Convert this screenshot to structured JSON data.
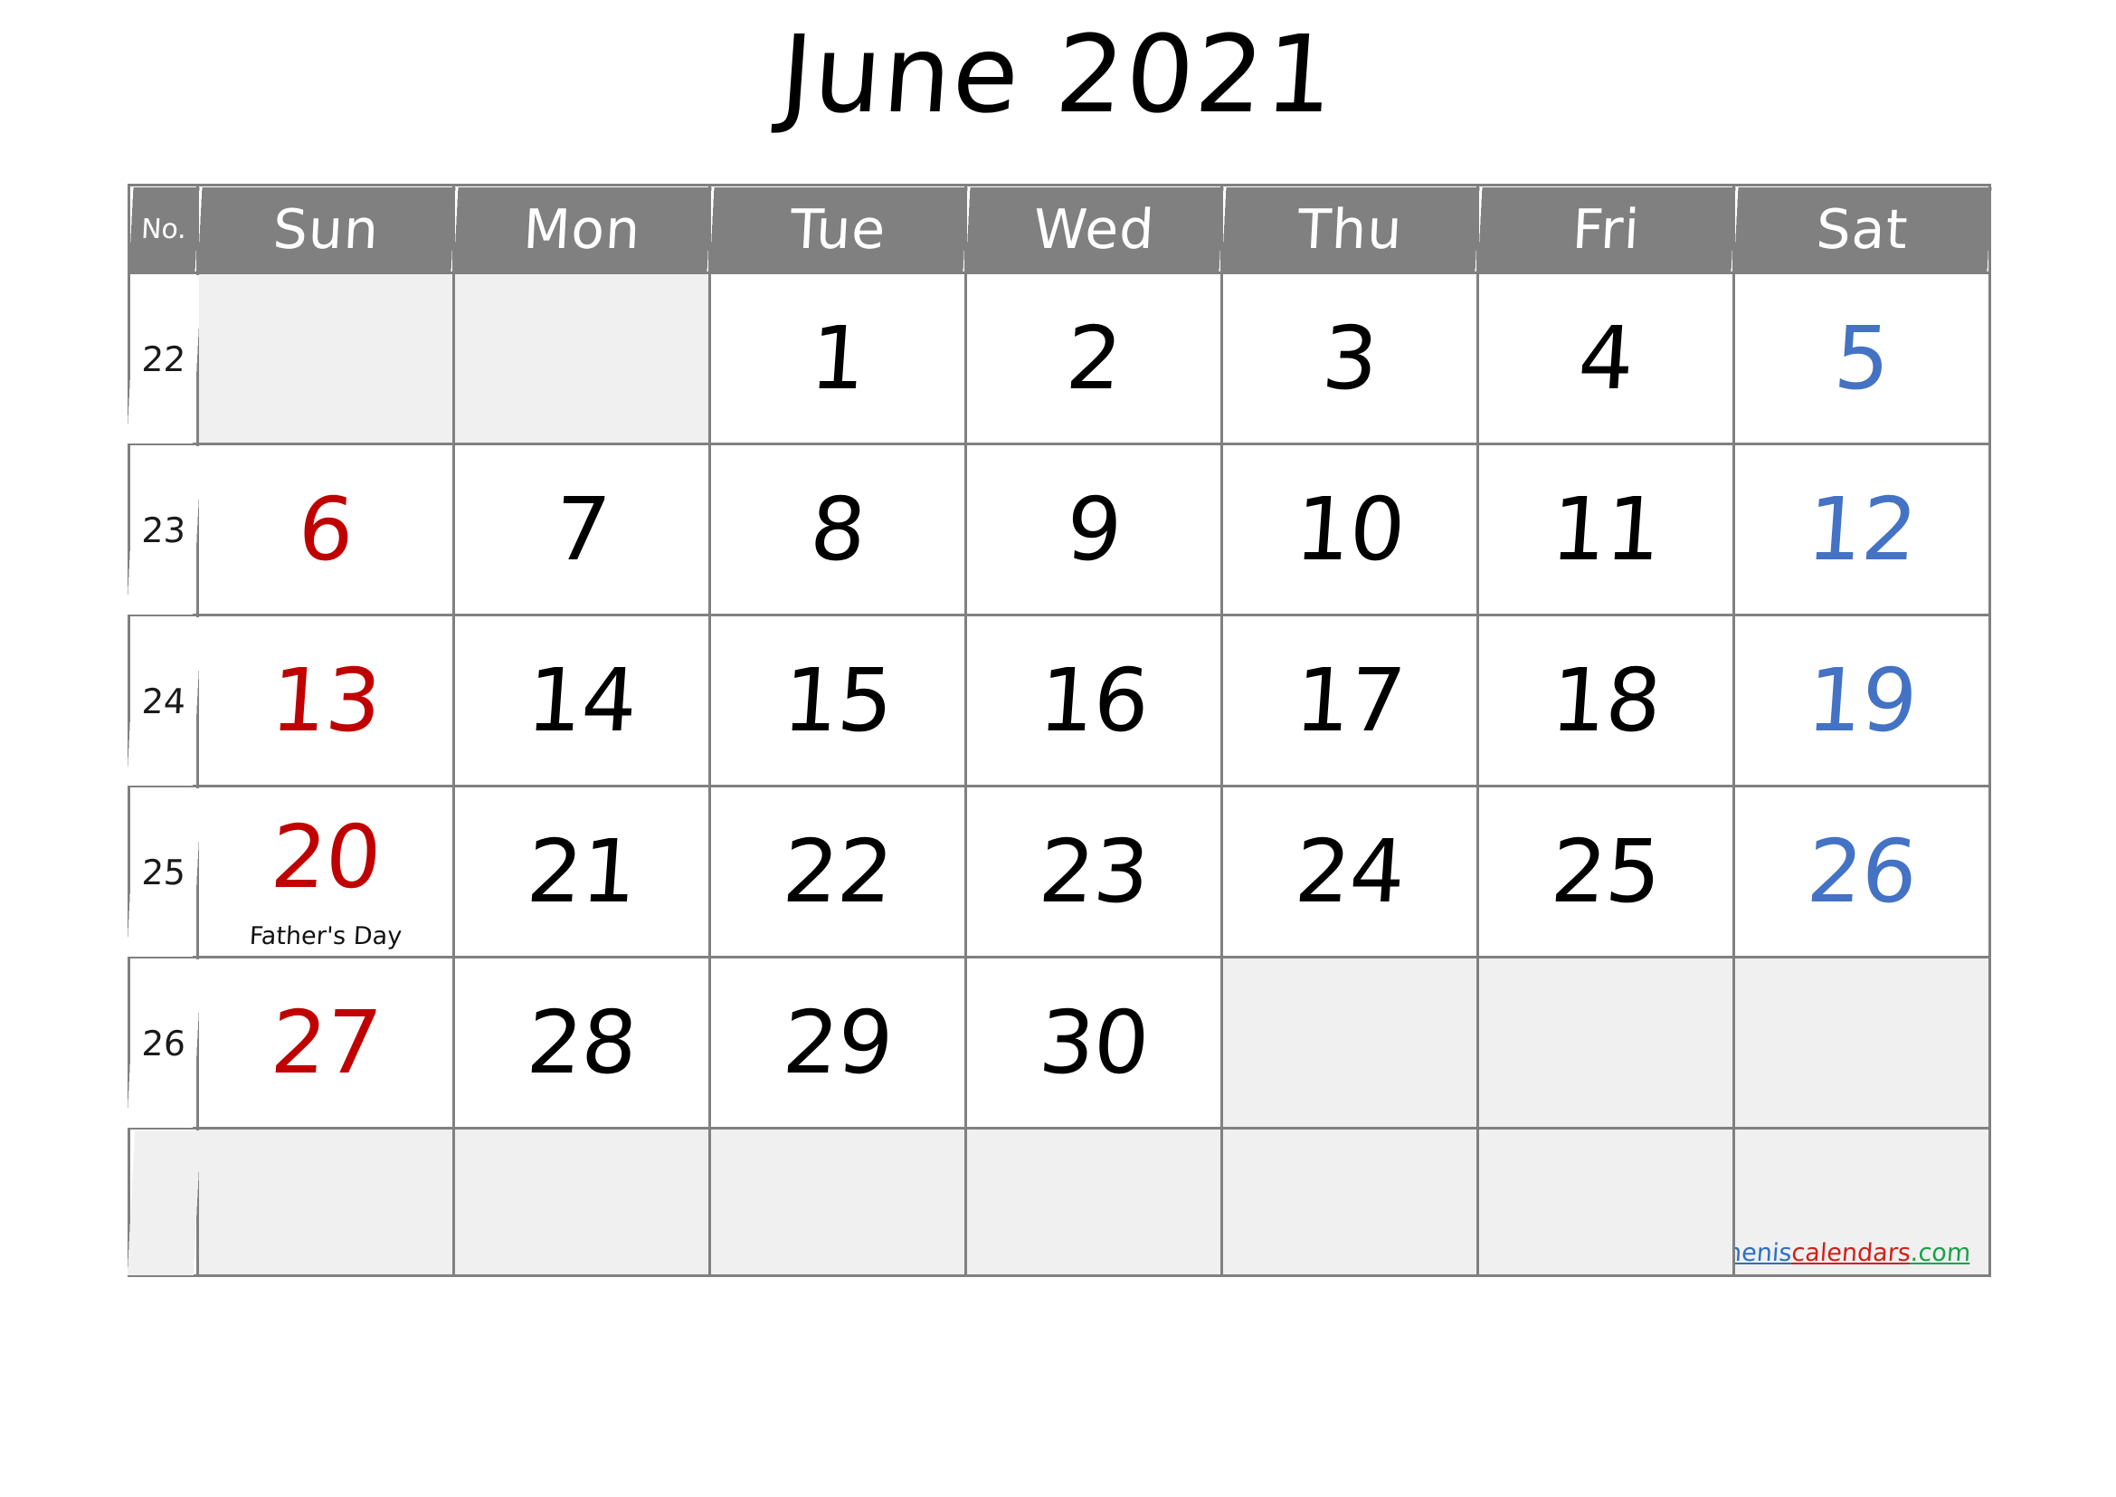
{
  "title": "June 2021",
  "header": {
    "week_no_label": "No.",
    "days": [
      "Sun",
      "Mon",
      "Tue",
      "Wed",
      "Thu",
      "Fri",
      "Sat"
    ]
  },
  "colors": {
    "header_bg": "#808080",
    "grid_line": "#808080",
    "blank_cell_bg": "#f0f0f0",
    "sunday_text": "#C00000",
    "saturday_text": "#4472C4",
    "weekday_text": "#000000"
  },
  "weeks": [
    {
      "week_no": "22",
      "week_no_blank": false,
      "days": [
        {
          "date": "",
          "blank": true,
          "event": ""
        },
        {
          "date": "",
          "blank": true,
          "event": ""
        },
        {
          "date": "1",
          "blank": false,
          "event": ""
        },
        {
          "date": "2",
          "blank": false,
          "event": ""
        },
        {
          "date": "3",
          "blank": false,
          "event": ""
        },
        {
          "date": "4",
          "blank": false,
          "event": ""
        },
        {
          "date": "5",
          "blank": false,
          "event": ""
        }
      ]
    },
    {
      "week_no": "23",
      "week_no_blank": false,
      "days": [
        {
          "date": "6",
          "blank": false,
          "event": ""
        },
        {
          "date": "7",
          "blank": false,
          "event": ""
        },
        {
          "date": "8",
          "blank": false,
          "event": ""
        },
        {
          "date": "9",
          "blank": false,
          "event": ""
        },
        {
          "date": "10",
          "blank": false,
          "event": ""
        },
        {
          "date": "11",
          "blank": false,
          "event": ""
        },
        {
          "date": "12",
          "blank": false,
          "event": ""
        }
      ]
    },
    {
      "week_no": "24",
      "week_no_blank": false,
      "days": [
        {
          "date": "13",
          "blank": false,
          "event": ""
        },
        {
          "date": "14",
          "blank": false,
          "event": ""
        },
        {
          "date": "15",
          "blank": false,
          "event": ""
        },
        {
          "date": "16",
          "blank": false,
          "event": ""
        },
        {
          "date": "17",
          "blank": false,
          "event": ""
        },
        {
          "date": "18",
          "blank": false,
          "event": ""
        },
        {
          "date": "19",
          "blank": false,
          "event": ""
        }
      ]
    },
    {
      "week_no": "25",
      "week_no_blank": false,
      "days": [
        {
          "date": "20",
          "blank": false,
          "event": "Father's Day"
        },
        {
          "date": "21",
          "blank": false,
          "event": ""
        },
        {
          "date": "22",
          "blank": false,
          "event": ""
        },
        {
          "date": "23",
          "blank": false,
          "event": ""
        },
        {
          "date": "24",
          "blank": false,
          "event": ""
        },
        {
          "date": "25",
          "blank": false,
          "event": ""
        },
        {
          "date": "26",
          "blank": false,
          "event": ""
        }
      ]
    },
    {
      "week_no": "26",
      "week_no_blank": false,
      "days": [
        {
          "date": "27",
          "blank": false,
          "event": ""
        },
        {
          "date": "28",
          "blank": false,
          "event": ""
        },
        {
          "date": "29",
          "blank": false,
          "event": ""
        },
        {
          "date": "30",
          "blank": false,
          "event": ""
        },
        {
          "date": "",
          "blank": true,
          "event": ""
        },
        {
          "date": "",
          "blank": true,
          "event": ""
        },
        {
          "date": "",
          "blank": true,
          "event": ""
        }
      ]
    },
    {
      "week_no": "",
      "week_no_blank": true,
      "days": [
        {
          "date": "",
          "blank": true,
          "event": ""
        },
        {
          "date": "",
          "blank": true,
          "event": ""
        },
        {
          "date": "",
          "blank": true,
          "event": ""
        },
        {
          "date": "",
          "blank": true,
          "event": ""
        },
        {
          "date": "",
          "blank": true,
          "event": ""
        },
        {
          "date": "",
          "blank": true,
          "event": ""
        },
        {
          "date": "",
          "blank": true,
          "event": ""
        }
      ]
    }
  ],
  "watermark": {
    "part_blue": "whenis",
    "part_red": "calendars",
    "part_green": ".com"
  }
}
